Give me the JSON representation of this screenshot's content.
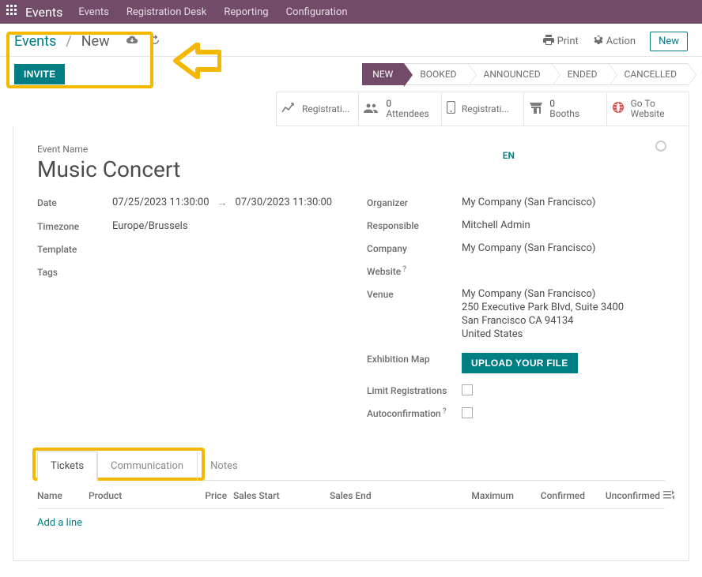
{
  "topbar": {
    "brand": "Events",
    "menu": [
      "Events",
      "Registration Desk",
      "Reporting",
      "Configuration"
    ]
  },
  "breadcrumb": {
    "root": "Events",
    "current": "New"
  },
  "right": {
    "print": "Print",
    "action": "Action",
    "new": "New"
  },
  "invite": "INVITE",
  "stages": [
    "NEW",
    "BOOKED",
    "ANNOUNCED",
    "ENDED",
    "CANCELLED"
  ],
  "statcards": {
    "registration": "Registrati...",
    "attendees_n": "0",
    "attendees": "Attendees",
    "registration2": "Registrati...",
    "booths_n": "0",
    "booths": "Booths",
    "goto1": "Go To",
    "goto2": "Website"
  },
  "event": {
    "name_label": "Event Name",
    "name": "Music Concert",
    "lang": "EN",
    "labels": {
      "date": "Date",
      "tz": "Timezone",
      "template": "Template",
      "tags": "Tags",
      "organizer": "Organizer",
      "responsible": "Responsible",
      "company": "Company",
      "website": "Website",
      "venue": "Venue",
      "exmap": "Exhibition Map",
      "limit": "Limit Registrations",
      "autoconf": "Autoconfirmation"
    },
    "date_start": "07/25/2023 11:30:00",
    "date_end": "07/30/2023 11:30:00",
    "tz": "Europe/Brussels",
    "organizer": "My Company (San Francisco)",
    "responsible": "Mitchell Admin",
    "company": "My Company (San Francisco)",
    "venue_name": "My Company (San Francisco)",
    "venue_addr1": "250 Executive Park Blvd, Suite 3400",
    "venue_addr2": "San Francisco CA 94134",
    "venue_country": "United States",
    "upload": "UPLOAD YOUR FILE"
  },
  "tabs": [
    "Tickets",
    "Communication",
    "Notes"
  ],
  "ticket_cols": {
    "name": "Name",
    "product": "Product",
    "price": "Price",
    "sstart": "Sales Start",
    "send": "Sales End",
    "max": "Maximum",
    "conf": "Confirmed",
    "unconf": "Unconfirmed"
  },
  "addline": "Add a line"
}
